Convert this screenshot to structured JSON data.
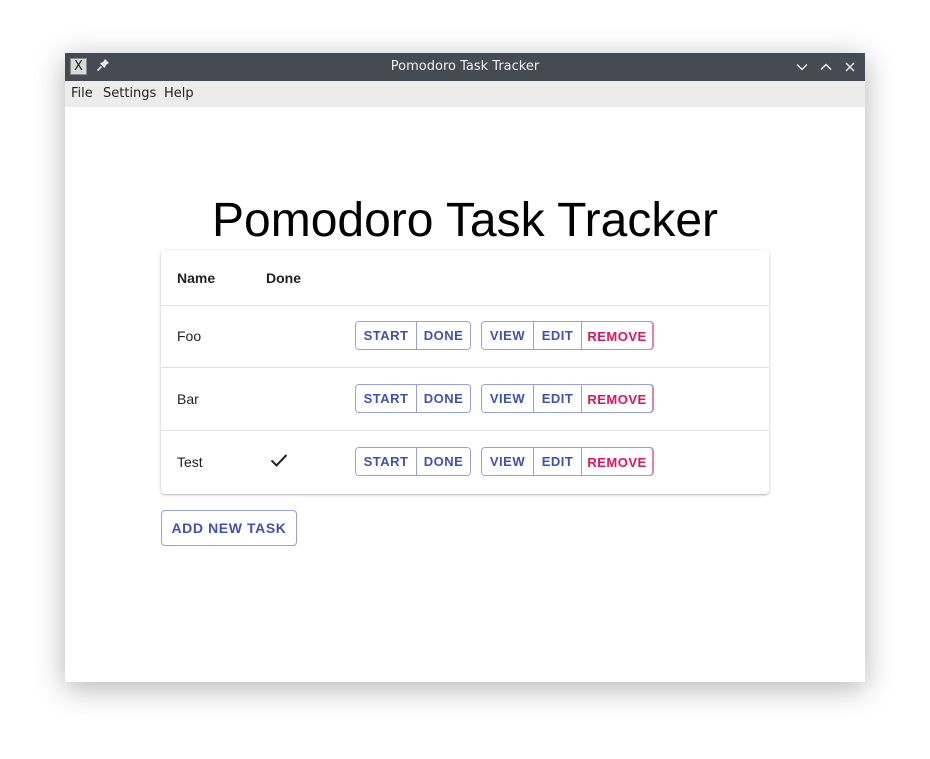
{
  "window": {
    "title": "Pomodoro Task Tracker",
    "titlebar_color": "#444b53",
    "app_icon_glyph": "X"
  },
  "menubar": {
    "items": [
      {
        "label": "File"
      },
      {
        "label": "Settings"
      },
      {
        "label": "Help"
      }
    ]
  },
  "main": {
    "heading": "Pomodoro Task Tracker",
    "table": {
      "headers": {
        "name": "Name",
        "done": "Done"
      },
      "rows": [
        {
          "name": "Foo",
          "done": false
        },
        {
          "name": "Bar",
          "done": false
        },
        {
          "name": "Test",
          "done": true
        }
      ]
    },
    "row_actions": {
      "start": "START",
      "done": "DONE",
      "view": "VIEW",
      "edit": "EDIT",
      "remove": "REMOVE"
    },
    "add_button": "ADD NEW TASK"
  },
  "colors": {
    "primary": "#3f51b5",
    "danger": "#e0135e"
  },
  "icons": {
    "app": "app-icon",
    "pin": "pin-icon",
    "minimize": "chevron-down-icon",
    "maximize": "chevron-up-icon",
    "close": "close-icon",
    "done_check": "check-icon"
  }
}
